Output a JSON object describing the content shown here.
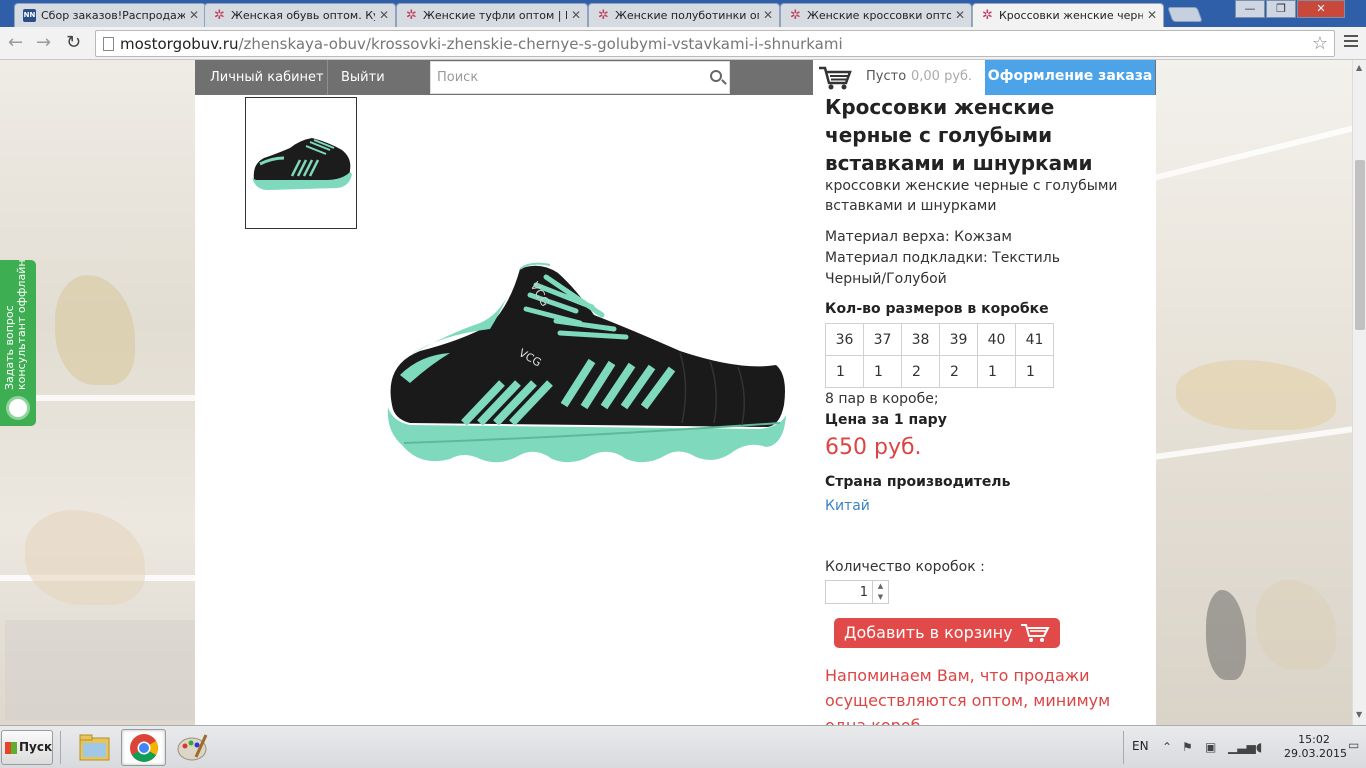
{
  "browser": {
    "tabs": [
      {
        "title": "Сбор заказов!Распродажа д",
        "icon": "nn-favicon",
        "active": false
      },
      {
        "title": "Женская обувь оптом. Купи",
        "icon": "star-favicon",
        "active": false
      },
      {
        "title": "Женские туфли оптом | Ве",
        "icon": "star-favicon",
        "active": false
      },
      {
        "title": "Женские полуботинки опто",
        "icon": "star-favicon",
        "active": false
      },
      {
        "title": "Женские кроссовки оптом",
        "icon": "star-favicon",
        "active": false
      },
      {
        "title": "Кроссовки женские черные",
        "icon": "star-favicon",
        "active": true
      }
    ],
    "url_host": "mostorgobuv.ru",
    "url_path": "/zhenskaya-obuv/krossovki-zhenskie-chernye-s-golubymi-vstavkami-i-shnurkami",
    "fav_nn": "NN",
    "tab_close": "✕",
    "win_controls": [
      "—",
      "❐",
      "✕"
    ]
  },
  "site": {
    "nav": {
      "account": "Личный кабинет",
      "logout": "Выйти",
      "search_placeholder": "Поиск"
    },
    "cart": {
      "empty_label": "Пусто",
      "sum": "0,00 руб.",
      "checkout": "Оформление заказа"
    },
    "consult": {
      "line1": "Задать вопрос",
      "line2": "консультант оффлайн"
    }
  },
  "product": {
    "title": "Кроссовки женские черные с голубыми вставками и шнурками",
    "description": "кроссовки женские черные с голубыми вставками и шнурками",
    "material_upper": "Материал верха: Кожзам",
    "material_lining": "Материал подкладки: Текстиль",
    "color": "Черный/Голубой",
    "sizes_heading": "Кол-во размеров в коробке",
    "sizes": [
      "36",
      "37",
      "38",
      "39",
      "40",
      "41"
    ],
    "counts": [
      "1",
      "1",
      "2",
      "2",
      "1",
      "1"
    ],
    "pairs_in_box": "8 пар в коробе;",
    "price_label": "Цена за 1 пару",
    "price": "650 руб.",
    "country_label": "Страна производитель",
    "country": "Китай",
    "qty_label": "Количество коробок :",
    "qty_value": "1",
    "add_to_cart": "Добавить в корзину",
    "notice": "Напоминаем Вам, что продажи осуществляются оптом, минимум одна короб"
  },
  "taskbar": {
    "start": "Пуск",
    "lang": "EN",
    "time": "15:02",
    "date": "29.03.2015"
  },
  "colors": {
    "accent_blue": "#4da3e8",
    "price_red": "#d44",
    "button_red": "#e24a4a",
    "consult_green": "#3eae52",
    "shoe_mint": "#7fd9bd"
  }
}
